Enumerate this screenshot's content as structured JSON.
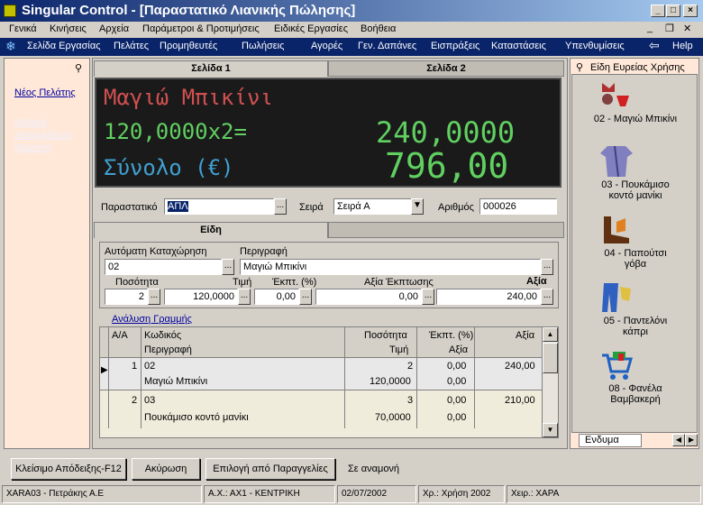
{
  "window": {
    "title": "Singular Control - [Παραστατικό Λιανικής Πώλησης]"
  },
  "menu": [
    "Γενικά",
    "Κινήσεις",
    "Αρχεία",
    "Παράμετροι & Προτιμήσεις",
    "Ειδικές Εργασίες",
    "Βοήθεια"
  ],
  "nav": [
    "Σελίδα Εργασίας",
    "Πελάτες",
    "Προμηθευτές",
    "Πωλήσεις",
    "Αγορές",
    "Γεν. Δαπάνες",
    "Εισπράξεις",
    "Καταστάσεις",
    "Υπενθυμίσεις",
    "Help"
  ],
  "left_links": {
    "new_customer": "Νέος Πελάτης",
    "change_rights": "Αλλαγή Δικαιωμάτων Χειριστή"
  },
  "tabs": {
    "page1": "Σελίδα 1",
    "page2": "Σελίδα 2",
    "items": "Είδη"
  },
  "display": {
    "line1": "Μαγιώ Μπικίνι",
    "line2_left": "120,0000x2=",
    "line2_right": "240,0000",
    "line3_left": "Σύνολο (€)",
    "line3_right": "796,00"
  },
  "doc": {
    "label": "Παραστατικό",
    "value": "ΑΠΛ",
    "series_label": "Σειρά",
    "series_value": "Σειρά Α",
    "number_label": "Αριθμός",
    "number_value": "000026"
  },
  "entry": {
    "auto_label": "Αυτόματη Καταχώρηση",
    "auto_value": "02",
    "desc_label": "Περιγραφή",
    "desc_value": "Μαγιώ Μπικίνι",
    "qty_label": "Ποσότητα",
    "qty_value": "2",
    "price_label": "Τιμή",
    "price_value": "120,0000",
    "disc_label": "Έκπτ. (%)",
    "disc_value": "0,00",
    "discval_label": "Αξία Έκπτωσης",
    "discval_value": "0,00",
    "value_label": "Αξία",
    "value_value": "240,00"
  },
  "grid": {
    "section_label": "Ανάλυση Γραμμής",
    "headers": {
      "aa": "Α/Α",
      "code": "Κωδικός",
      "desc": "Περιγραφή",
      "qty": "Ποσότητα",
      "price": "Τιμή",
      "disc": "Έκπτ. (%)",
      "discval": "Αξία",
      "value": "Αξία"
    },
    "rows": [
      {
        "aa": "1",
        "code": "02",
        "desc": "Μαγιώ Μπικίνι",
        "qty": "2",
        "price": "120,0000",
        "disc": "0,00",
        "discval": "0,00",
        "value": "240,00"
      },
      {
        "aa": "2",
        "code": "03",
        "desc": "Πουκάμισο κοντό μανίκι",
        "qty": "3",
        "price": "70,0000",
        "disc": "0,00",
        "discval": "0,00",
        "value": "210,00"
      }
    ]
  },
  "quick": {
    "title": "Είδη Ευρείας Χρήσης",
    "items": [
      {
        "line1": "02 - Μαγιώ Μπικίνι",
        "line2": "",
        "icon": "bikini-icon"
      },
      {
        "line1": "03 - Πουκάμισο",
        "line2": "κοντό μανίκι",
        "icon": "shirt-icon"
      },
      {
        "line1": "04 - Παπούτσι",
        "line2": "γόβα",
        "icon": "shoe-icon"
      },
      {
        "line1": "05 - Παντελόνι",
        "line2": "κάπρι",
        "icon": "trousers-icon"
      },
      {
        "line1": "08 - Φανέλα",
        "line2": "Βαμβακερή",
        "icon": "cart-icon"
      }
    ],
    "tab_label": "Ενδυμα"
  },
  "buttons": {
    "close_receipt": "Κλείσιμο Απόδειξης-F12",
    "cancel": "Ακύρωση",
    "select_orders": "Επιλογή από Παραγγελίες",
    "pending": "Σε αναμονή"
  },
  "status": [
    "XARA03 - Πετράκης Α.Ε",
    "Α.Χ.: ΑΧ1 - ΚΕΝΤΡΙΚΗ",
    "02/07/2002",
    "Χρ.: Χρήση 2002",
    "Χειρ.: ΧΑΡΑ"
  ],
  "colors": {
    "display_red": "#d05050",
    "display_green": "#60d060",
    "display_cyan": "#40a0d0",
    "nav_bg": "#0a246a",
    "panel_bg": "#ffe8d8",
    "grid_bg": "#f0ecdc"
  }
}
